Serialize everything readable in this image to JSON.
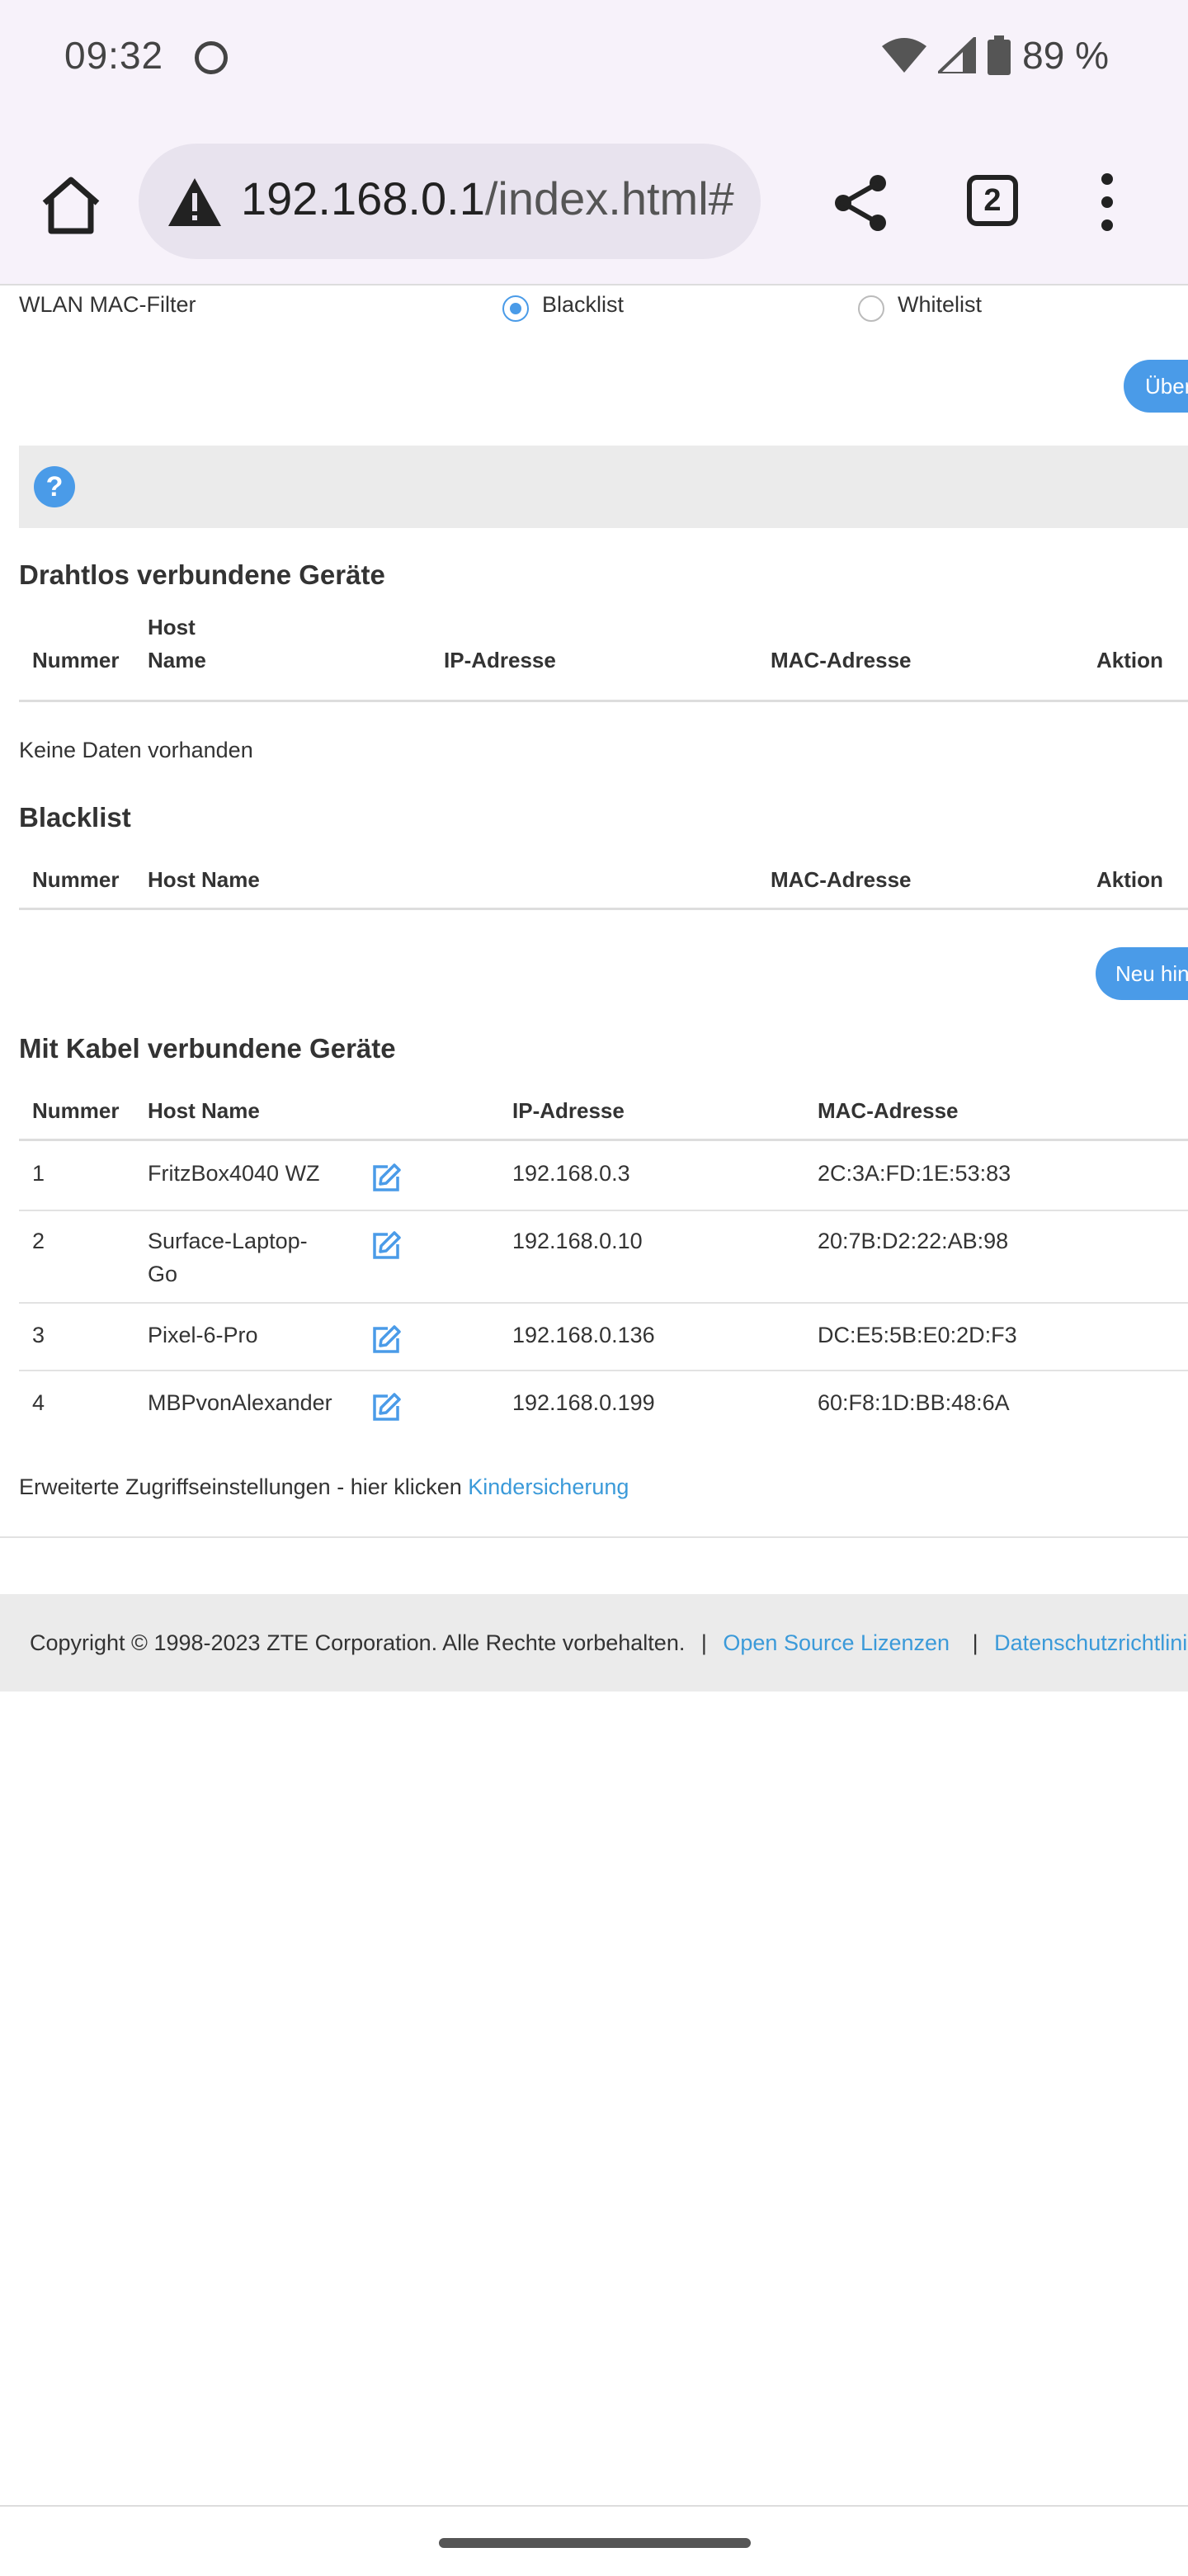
{
  "status_bar": {
    "time": "09:32",
    "battery": "89 %",
    "icons": [
      "wifi-icon",
      "signal-icon",
      "battery-icon"
    ]
  },
  "browser": {
    "url_host": "192.168.0.1",
    "url_path": "/index.html#",
    "tab_count": "2",
    "icons": [
      "home-icon",
      "warning-icon",
      "share-icon",
      "tabs-icon",
      "more-icon"
    ]
  },
  "wlan_filter": {
    "label": "WLAN MAC-Filter",
    "option_blacklist": "Blacklist",
    "option_whitelist": "Whitelist",
    "selected": "Blacklist",
    "apply_button": "Über"
  },
  "help": {
    "icon_text": "?"
  },
  "wireless_devices": {
    "title": "Drahtlos verbundene Geräte",
    "headers": {
      "number": "Nummer",
      "host_line1": "Host",
      "host_line2": "Name",
      "ip": "IP-Adresse",
      "mac": "MAC-Adresse",
      "action": "Aktion"
    },
    "empty_text": "Keine Daten vorhanden"
  },
  "blacklist": {
    "title": "Blacklist",
    "headers": {
      "number": "Nummer",
      "host": "Host Name",
      "mac": "MAC-Adresse",
      "action": "Aktion"
    },
    "add_button": "Neu hin"
  },
  "wired_devices": {
    "title": "Mit Kabel verbundene Geräte",
    "headers": {
      "number": "Nummer",
      "host": "Host Name",
      "ip": "IP-Adresse",
      "mac": "MAC-Adresse"
    },
    "rows": [
      {
        "number": "1",
        "host_line1": "FritzBox4040 WZ",
        "host_line2": "",
        "ip": "192.168.0.3",
        "mac": "2C:3A:FD:1E:53:83"
      },
      {
        "number": "2",
        "host_line1": "Surface-Laptop-",
        "host_line2": "Go",
        "ip": "192.168.0.10",
        "mac": "20:7B:D2:22:AB:98"
      },
      {
        "number": "3",
        "host_line1": "Pixel-6-Pro",
        "host_line2": "",
        "ip": "192.168.0.136",
        "mac": "DC:E5:5B:E0:2D:F3"
      },
      {
        "number": "4",
        "host_line1": "MBPvonAlexander",
        "host_line2": "",
        "ip": "192.168.0.199",
        "mac": "60:F8:1D:BB:48:6A"
      }
    ]
  },
  "advanced_access": {
    "text": "Erweiterte Zugriffseinstellungen - hier klicken",
    "link": "Kindersicherung"
  },
  "footer": {
    "copyright": "Copyright © 1998-2023 ZTE Corporation. Alle Rechte vorbehalten.",
    "separator": "|",
    "link_open_source": "Open Source Lizenzen",
    "link_privacy": "Datenschutzrichtlinie"
  },
  "colors": {
    "accent": "#4a9be8",
    "link": "#3b9ad9",
    "chrome_bg": "#f7f2fa",
    "footer_bg": "#ebebeb"
  }
}
